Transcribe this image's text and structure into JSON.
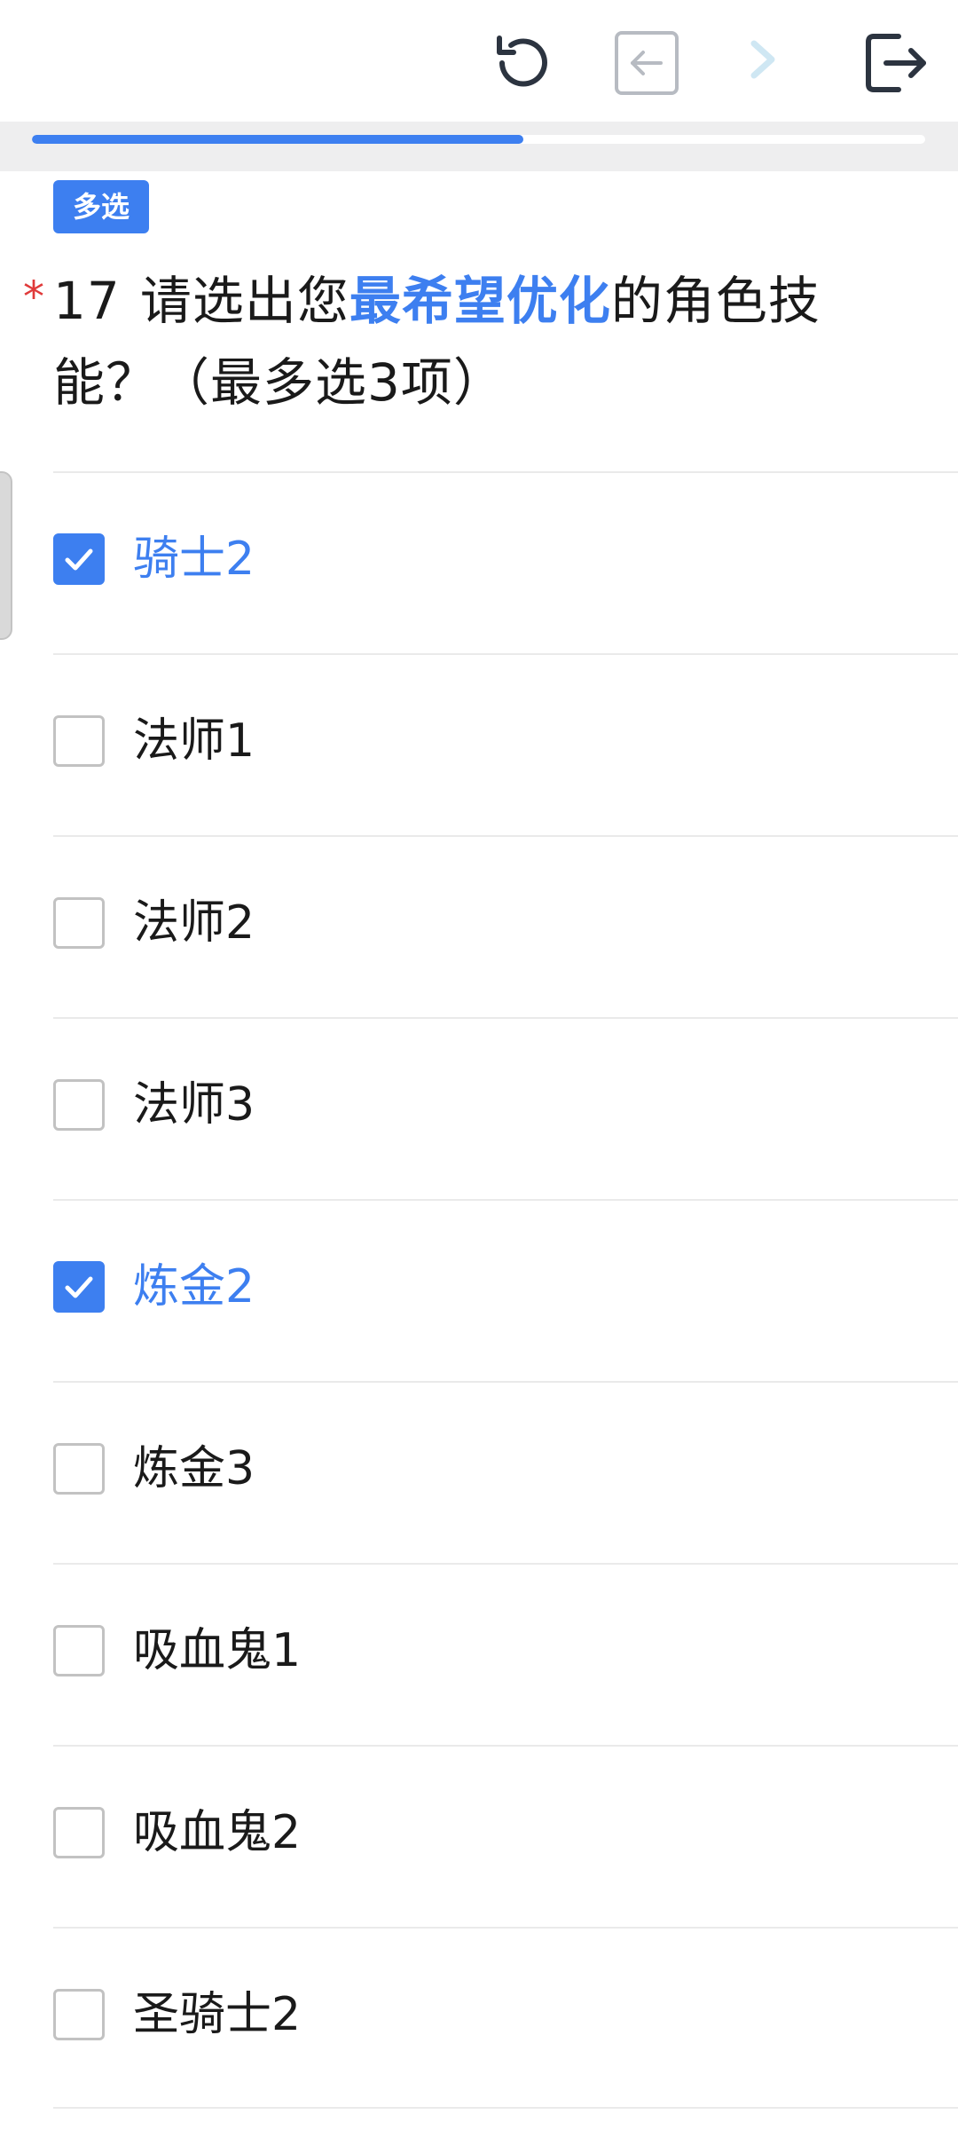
{
  "toolbar": {
    "icons": [
      "refresh-icon",
      "back-icon",
      "forward-icon",
      "exit-icon"
    ]
  },
  "progress": {
    "fraction": 0.55,
    "fill_color": "#3d7ff0"
  },
  "question": {
    "type_badge": "多选",
    "required_mark": "*",
    "number": "17",
    "text_before": "请选出您",
    "text_highlight": "最希望优化",
    "text_after": "的角色技能？（最多选3项）"
  },
  "options": [
    {
      "label": "骑士2",
      "checked": true
    },
    {
      "label": "法师1",
      "checked": false
    },
    {
      "label": "法师2",
      "checked": false
    },
    {
      "label": "法师3",
      "checked": false
    },
    {
      "label": "炼金2",
      "checked": true
    },
    {
      "label": "炼金3",
      "checked": false
    },
    {
      "label": "吸血鬼1",
      "checked": false
    },
    {
      "label": "吸血鬼2",
      "checked": false
    },
    {
      "label": "圣骑士2",
      "checked": false
    }
  ],
  "colors": {
    "accent": "#3d7ff0",
    "required": "#e03a3a",
    "text": "#1a1a1a"
  }
}
